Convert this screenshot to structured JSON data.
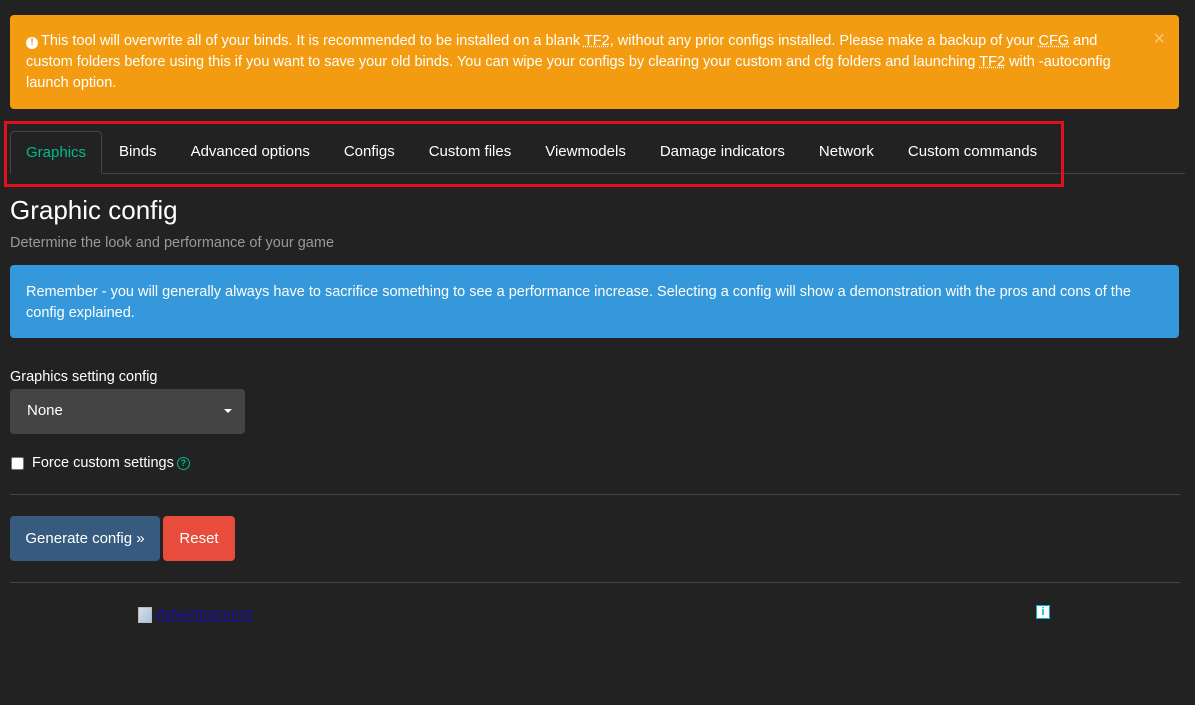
{
  "warning": {
    "icon": "exclamation-circle-icon",
    "line1_a": "This tool will overwrite all of your binds. It is recommended to be installed on a blank ",
    "abbr1": "TF2",
    "line1_b": ", without any prior configs installed. Please make a backup of your ",
    "abbr2": "CFG",
    "line1_c": " and",
    "line2_a": "custom folders before using this if you want to save your old binds. You can wipe your configs by clearing your custom and cfg folders and launching ",
    "abbr3": "TF2",
    "line2_b": " with -autoconfig",
    "line3": "launch option.",
    "close": "×"
  },
  "tabs": [
    {
      "label": "Graphics",
      "active": true
    },
    {
      "label": "Binds"
    },
    {
      "label": "Advanced options"
    },
    {
      "label": "Configs"
    },
    {
      "label": "Custom files"
    },
    {
      "label": "Viewmodels"
    },
    {
      "label": "Damage indicators"
    },
    {
      "label": "Network"
    },
    {
      "label": "Custom commands"
    }
  ],
  "main": {
    "title": "Graphic config",
    "subtitle": "Determine the look and performance of your game",
    "info": "Remember - you will generally always have to sacrifice something to see a performance increase. Selecting a config will show a demonstration with the pros and cons of the config explained."
  },
  "form": {
    "select_label": "Graphics setting config",
    "select_value": "None",
    "checkbox_label": "Force custom settings",
    "help_icon": "?",
    "generate_label": "Generate config »",
    "reset_label": "Reset"
  },
  "ad": {
    "alt": "Advertisement",
    "info_icon": "i"
  },
  "colors": {
    "background": "#222222",
    "warning": "#f39c12",
    "info": "#3498db",
    "accent": "#00bc8c",
    "primary": "#375a7f",
    "danger": "#e74c3c",
    "highlight": "#e0101e"
  }
}
